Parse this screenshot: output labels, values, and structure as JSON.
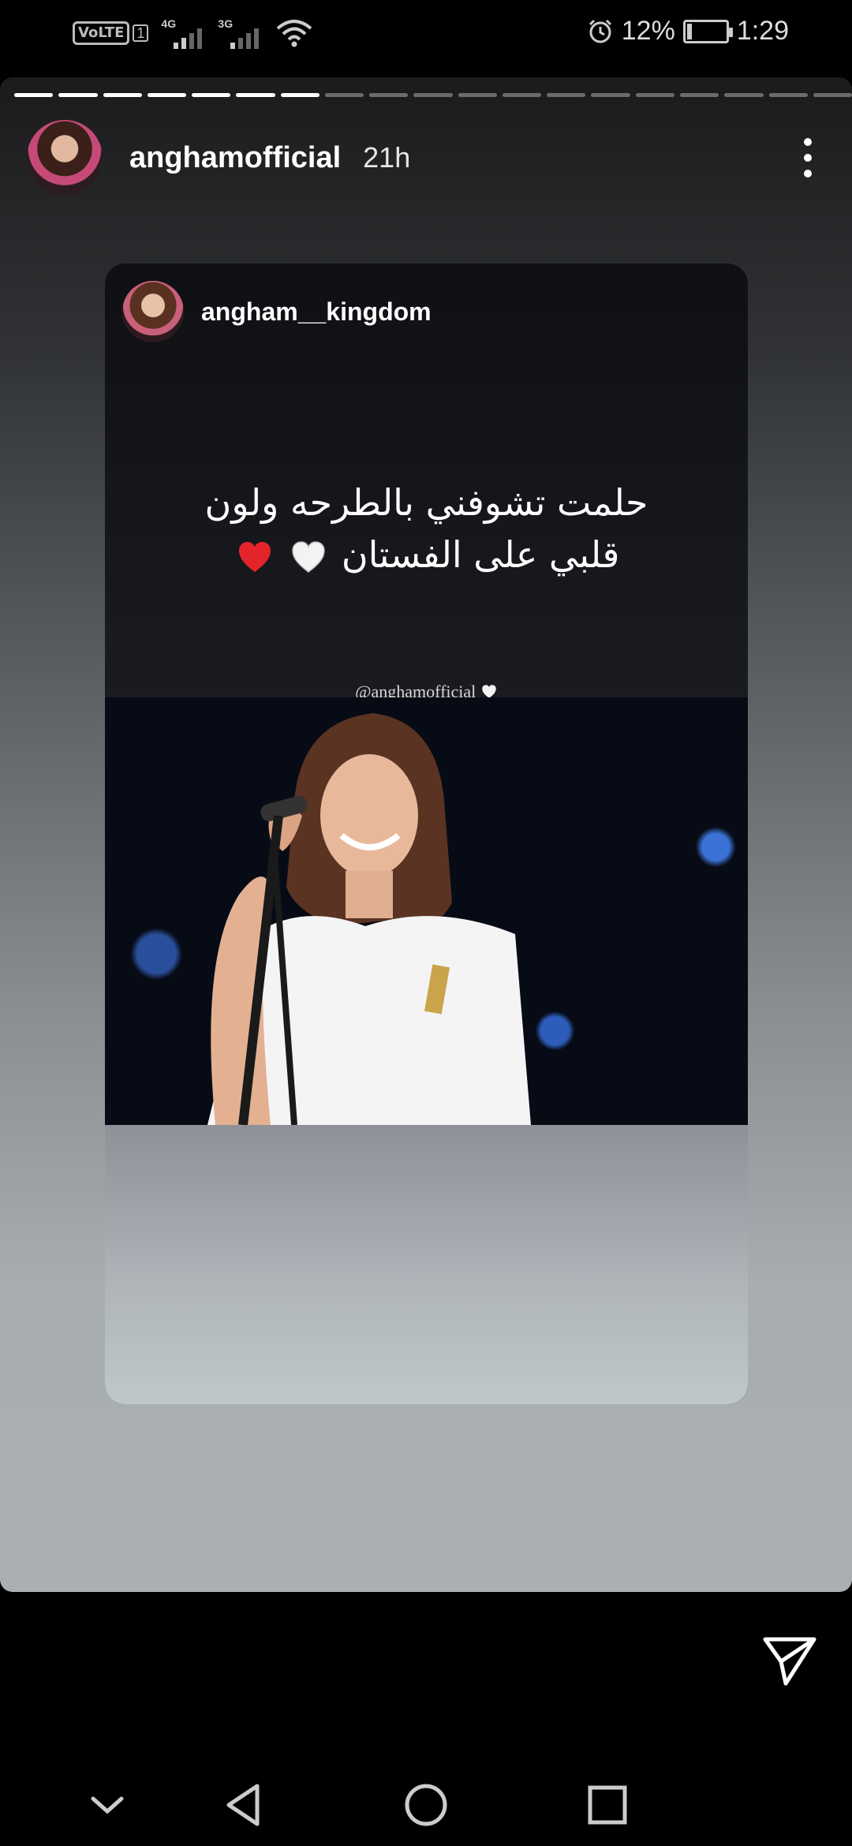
{
  "status_bar": {
    "volte": "VoLTE",
    "sim": "1",
    "net1": "4G",
    "net2": "3G",
    "battery_percent": "12%",
    "battery_level": 0.12,
    "time": "1:29",
    "icons": [
      "alarm-icon",
      "battery-icon",
      "wifi-icon",
      "signal-icon"
    ]
  },
  "story": {
    "progress_segments": 19,
    "progress_completed": 7,
    "author": "anghamofficial",
    "time_ago": "21h",
    "menu_icon": "more-vertical-icon"
  },
  "post": {
    "username": "angham__kingdom",
    "caption_line1": "حلمت تشوفني بالطرحه ولون",
    "caption_line2": "قلبي على الفستان",
    "mention_prefix": "@",
    "mention_user": "anghamofficial",
    "photo_description": "singer in white dress at microphone"
  },
  "actions": {
    "send_icon": "send-icon"
  },
  "navbar": {
    "icons": [
      "chevron-down-icon",
      "back-icon",
      "home-icon",
      "recents-icon"
    ]
  },
  "colors": {
    "heart_white": "#f3f3f3",
    "heart_red": "#e3242b"
  }
}
